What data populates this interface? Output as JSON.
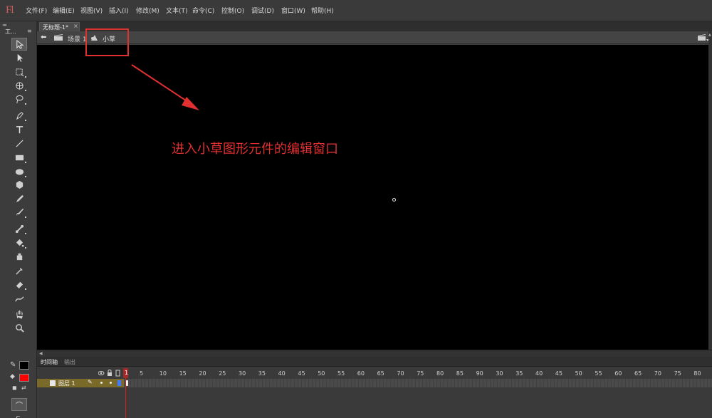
{
  "app": {
    "logo": "Fl"
  },
  "menu": [
    "文件(F)",
    "编辑(E)",
    "视图(V)",
    "插入(I)",
    "修改(M)",
    "文本(T)",
    "命令(C)",
    "控制(O)",
    "调试(D)",
    "窗口(W)",
    "帮助(H)"
  ],
  "document_tab": {
    "label": "无标题-1*",
    "close": "×"
  },
  "edit_bar": {
    "scene_label": "场景 1",
    "symbol_label": "小草"
  },
  "tools_panel": {
    "title": "工...",
    "menu_icon": "≡"
  },
  "annotation": {
    "text": "进入小草图形元件的编辑窗口",
    "color": "#e03030"
  },
  "timeline": {
    "tabs": [
      "时间轴",
      "输出"
    ],
    "frame_numbers": [
      "1",
      "5",
      "10",
      "15",
      "20",
      "25",
      "30",
      "35",
      "40",
      "45",
      "50",
      "55",
      "60",
      "65",
      "70",
      "75",
      "80",
      "85",
      "90",
      "30",
      "35",
      "40",
      "45",
      "50",
      "55",
      "60",
      "65",
      "70",
      "75",
      "80"
    ],
    "playhead_frame": "1",
    "layer": {
      "name": "图层 1"
    }
  },
  "colors": {
    "stroke": "#000000",
    "fill": "#ff0000",
    "stage": "#000000",
    "layer_highlight": "#7a6a2a"
  }
}
